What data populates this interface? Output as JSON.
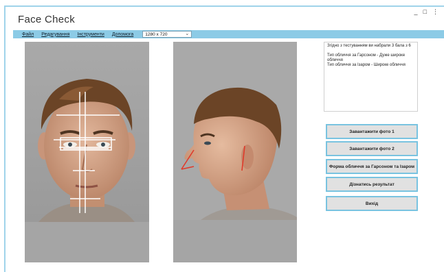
{
  "window": {
    "title": "Face Check",
    "controls": [
      "_",
      "□",
      "⋮"
    ]
  },
  "menu": {
    "items": [
      "Файл",
      "Редагування",
      "Інструменти",
      "Допомога"
    ],
    "resolution_select": "1280 x 720"
  },
  "results": {
    "line1": "Згідно з тестуванням ви набрали 3 бала з 6",
    "line2": "Тип обличчя за Гарсоном - Дуже широке обличчя",
    "line3": "Тип обличчя за Ізаром - Широке обличчя"
  },
  "buttons": {
    "load_photo_1": "Завантажити фото 1",
    "load_photo_2": "Завантажити фото 2",
    "face_shape": "Форма обличчя за Гарсоном та Ізаром",
    "get_result": "Дізнатись результат",
    "exit": "Вихід"
  },
  "colors": {
    "accent": "#8ccbe6",
    "button_border": "#79c3e0",
    "photo_background": "#a3a3a3",
    "measure_lines": "#ffffff",
    "profile_marker": "#e03a2a"
  }
}
